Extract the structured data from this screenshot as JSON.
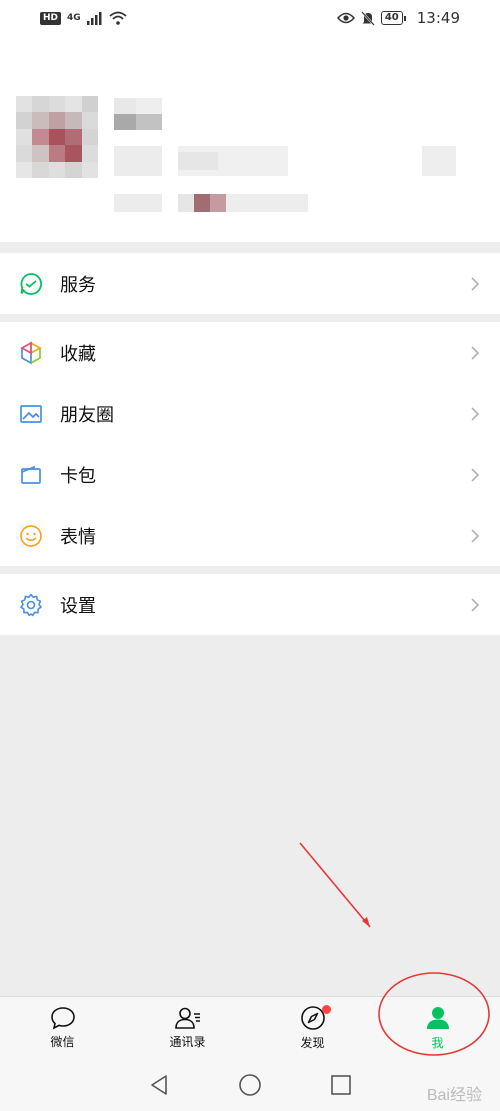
{
  "status_bar": {
    "hd": "HD",
    "network": "4G",
    "battery": "40",
    "time": "13:49"
  },
  "menu": {
    "services": "服务",
    "favorites": "收藏",
    "moments": "朋友圈",
    "cards": "卡包",
    "stickers": "表情",
    "settings": "设置"
  },
  "tabs": [
    {
      "label": "微信",
      "icon": "chat-bubble-icon"
    },
    {
      "label": "通讯录",
      "icon": "contacts-icon"
    },
    {
      "label": "发现",
      "icon": "compass-icon",
      "badge_dot": true
    },
    {
      "label": "我",
      "icon": "person-icon",
      "active": true
    }
  ],
  "colors": {
    "accent": "#07c160",
    "annotation": "#e53935",
    "badge": "#ff4444"
  },
  "watermark": "Bai经验"
}
